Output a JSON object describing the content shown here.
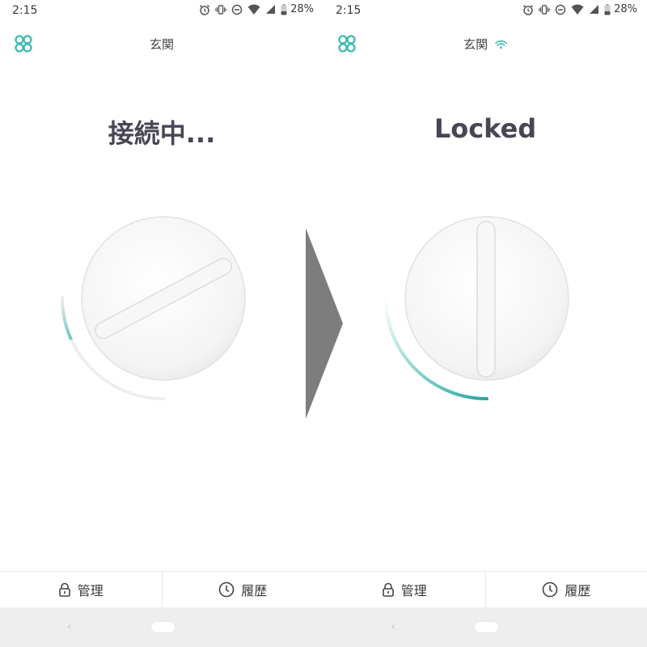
{
  "screens": [
    {
      "status_bar": {
        "time": "2:15",
        "battery": "28%"
      },
      "header": {
        "title": "玄関",
        "wifi_connected": false
      },
      "lock_status": {
        "text": "接続中...",
        "state": "connecting"
      },
      "tabs": [
        {
          "label": "管理",
          "icon": "lock-icon"
        },
        {
          "label": "履歴",
          "icon": "clock-icon"
        }
      ]
    },
    {
      "status_bar": {
        "time": "2:15",
        "battery": "28%"
      },
      "header": {
        "title": "玄関",
        "wifi_connected": true
      },
      "lock_status": {
        "text": "Locked",
        "state": "locked"
      },
      "tabs": [
        {
          "label": "管理",
          "icon": "lock-icon"
        },
        {
          "label": "履歴",
          "icon": "clock-icon"
        }
      ]
    }
  ],
  "colors": {
    "accent": "#3db8b1",
    "heading": "#484654",
    "arrow": "#7d7d7d",
    "navbar": "#eeeeee"
  }
}
